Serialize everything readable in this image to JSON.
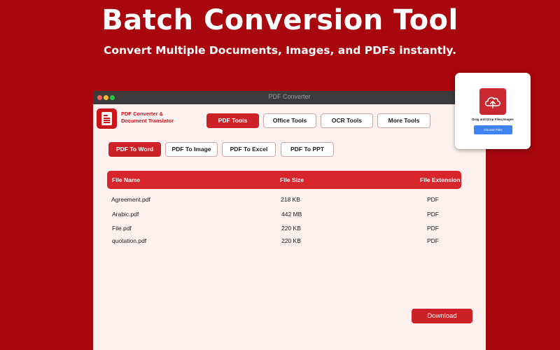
{
  "hero": {
    "title": "Batch Conversion Tool",
    "subtitle": "Convert Multiple Documents, Images, and PDFs instantly."
  },
  "window": {
    "title": "PDF Converter"
  },
  "brand": {
    "name_line1": "PDF Converter &",
    "name_line2": "Document Translator",
    "logo_icon": "pdf-document-icon"
  },
  "main_tabs": [
    {
      "label": "PDF Tools",
      "active": true
    },
    {
      "label": "Office Tools",
      "active": false
    },
    {
      "label": "OCR Tools",
      "active": false
    },
    {
      "label": "More Tools",
      "active": false
    }
  ],
  "sub_tabs": [
    {
      "label": "PDF To Word",
      "active": true
    },
    {
      "label": "PDF To Image",
      "active": false
    },
    {
      "label": "PDF To Excel",
      "active": false
    },
    {
      "label": "PDF To PPT",
      "active": false
    }
  ],
  "table": {
    "columns": [
      "File Name",
      "File Size",
      "File Extension"
    ],
    "rows": [
      [
        "Agreement.pdf",
        "218 KB",
        "PDF"
      ],
      [
        "Arabic.pdf",
        "442 MB",
        "PDF"
      ],
      [
        "File.pdf",
        "220 KB",
        "PDF"
      ],
      [
        "quotation.pdf",
        "220 KB",
        "PDF"
      ]
    ]
  },
  "download_label": "Download",
  "drop_zone": {
    "icon": "cloud-upload-icon",
    "text": "Drag and Drop Files,Images",
    "button_label": "Choose Files"
  },
  "colors": {
    "background": "#a8070d",
    "accent": "#cc2127",
    "window_bg": "#fdf1ef",
    "choose_button": "#3f83f0"
  }
}
